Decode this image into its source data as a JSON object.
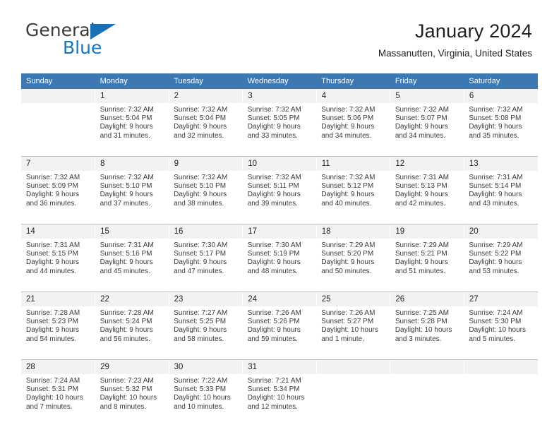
{
  "brand": {
    "name_top": "General",
    "name_bottom": "Blue",
    "mark": "triangle-logo",
    "color_blue": "#1577bf",
    "color_dark": "#3b3b3d"
  },
  "header": {
    "title": "January 2024",
    "subtitle": "Massanutten, Virginia, United States"
  },
  "theme": {
    "header_bg": "#3c79b4",
    "daynum_bg": "#f2f2f2",
    "row_divider": "#a9bcd2"
  },
  "calendar": {
    "weekday_headers": [
      "Sunday",
      "Monday",
      "Tuesday",
      "Wednesday",
      "Thursday",
      "Friday",
      "Saturday"
    ],
    "weeks": [
      {
        "days": [
          {
            "num": "",
            "sunrise": "",
            "sunset": "",
            "daylight1": "",
            "daylight2": ""
          },
          {
            "num": "1",
            "sunrise": "Sunrise: 7:32 AM",
            "sunset": "Sunset: 5:04 PM",
            "daylight1": "Daylight: 9 hours",
            "daylight2": "and 31 minutes."
          },
          {
            "num": "2",
            "sunrise": "Sunrise: 7:32 AM",
            "sunset": "Sunset: 5:04 PM",
            "daylight1": "Daylight: 9 hours",
            "daylight2": "and 32 minutes."
          },
          {
            "num": "3",
            "sunrise": "Sunrise: 7:32 AM",
            "sunset": "Sunset: 5:05 PM",
            "daylight1": "Daylight: 9 hours",
            "daylight2": "and 33 minutes."
          },
          {
            "num": "4",
            "sunrise": "Sunrise: 7:32 AM",
            "sunset": "Sunset: 5:06 PM",
            "daylight1": "Daylight: 9 hours",
            "daylight2": "and 34 minutes."
          },
          {
            "num": "5",
            "sunrise": "Sunrise: 7:32 AM",
            "sunset": "Sunset: 5:07 PM",
            "daylight1": "Daylight: 9 hours",
            "daylight2": "and 34 minutes."
          },
          {
            "num": "6",
            "sunrise": "Sunrise: 7:32 AM",
            "sunset": "Sunset: 5:08 PM",
            "daylight1": "Daylight: 9 hours",
            "daylight2": "and 35 minutes."
          }
        ]
      },
      {
        "days": [
          {
            "num": "7",
            "sunrise": "Sunrise: 7:32 AM",
            "sunset": "Sunset: 5:09 PM",
            "daylight1": "Daylight: 9 hours",
            "daylight2": "and 36 minutes."
          },
          {
            "num": "8",
            "sunrise": "Sunrise: 7:32 AM",
            "sunset": "Sunset: 5:10 PM",
            "daylight1": "Daylight: 9 hours",
            "daylight2": "and 37 minutes."
          },
          {
            "num": "9",
            "sunrise": "Sunrise: 7:32 AM",
            "sunset": "Sunset: 5:10 PM",
            "daylight1": "Daylight: 9 hours",
            "daylight2": "and 38 minutes."
          },
          {
            "num": "10",
            "sunrise": "Sunrise: 7:32 AM",
            "sunset": "Sunset: 5:11 PM",
            "daylight1": "Daylight: 9 hours",
            "daylight2": "and 39 minutes."
          },
          {
            "num": "11",
            "sunrise": "Sunrise: 7:32 AM",
            "sunset": "Sunset: 5:12 PM",
            "daylight1": "Daylight: 9 hours",
            "daylight2": "and 40 minutes."
          },
          {
            "num": "12",
            "sunrise": "Sunrise: 7:31 AM",
            "sunset": "Sunset: 5:13 PM",
            "daylight1": "Daylight: 9 hours",
            "daylight2": "and 42 minutes."
          },
          {
            "num": "13",
            "sunrise": "Sunrise: 7:31 AM",
            "sunset": "Sunset: 5:14 PM",
            "daylight1": "Daylight: 9 hours",
            "daylight2": "and 43 minutes."
          }
        ]
      },
      {
        "days": [
          {
            "num": "14",
            "sunrise": "Sunrise: 7:31 AM",
            "sunset": "Sunset: 5:15 PM",
            "daylight1": "Daylight: 9 hours",
            "daylight2": "and 44 minutes."
          },
          {
            "num": "15",
            "sunrise": "Sunrise: 7:31 AM",
            "sunset": "Sunset: 5:16 PM",
            "daylight1": "Daylight: 9 hours",
            "daylight2": "and 45 minutes."
          },
          {
            "num": "16",
            "sunrise": "Sunrise: 7:30 AM",
            "sunset": "Sunset: 5:17 PM",
            "daylight1": "Daylight: 9 hours",
            "daylight2": "and 47 minutes."
          },
          {
            "num": "17",
            "sunrise": "Sunrise: 7:30 AM",
            "sunset": "Sunset: 5:19 PM",
            "daylight1": "Daylight: 9 hours",
            "daylight2": "and 48 minutes."
          },
          {
            "num": "18",
            "sunrise": "Sunrise: 7:29 AM",
            "sunset": "Sunset: 5:20 PM",
            "daylight1": "Daylight: 9 hours",
            "daylight2": "and 50 minutes."
          },
          {
            "num": "19",
            "sunrise": "Sunrise: 7:29 AM",
            "sunset": "Sunset: 5:21 PM",
            "daylight1": "Daylight: 9 hours",
            "daylight2": "and 51 minutes."
          },
          {
            "num": "20",
            "sunrise": "Sunrise: 7:29 AM",
            "sunset": "Sunset: 5:22 PM",
            "daylight1": "Daylight: 9 hours",
            "daylight2": "and 53 minutes."
          }
        ]
      },
      {
        "days": [
          {
            "num": "21",
            "sunrise": "Sunrise: 7:28 AM",
            "sunset": "Sunset: 5:23 PM",
            "daylight1": "Daylight: 9 hours",
            "daylight2": "and 54 minutes."
          },
          {
            "num": "22",
            "sunrise": "Sunrise: 7:28 AM",
            "sunset": "Sunset: 5:24 PM",
            "daylight1": "Daylight: 9 hours",
            "daylight2": "and 56 minutes."
          },
          {
            "num": "23",
            "sunrise": "Sunrise: 7:27 AM",
            "sunset": "Sunset: 5:25 PM",
            "daylight1": "Daylight: 9 hours",
            "daylight2": "and 58 minutes."
          },
          {
            "num": "24",
            "sunrise": "Sunrise: 7:26 AM",
            "sunset": "Sunset: 5:26 PM",
            "daylight1": "Daylight: 9 hours",
            "daylight2": "and 59 minutes."
          },
          {
            "num": "25",
            "sunrise": "Sunrise: 7:26 AM",
            "sunset": "Sunset: 5:27 PM",
            "daylight1": "Daylight: 10 hours",
            "daylight2": "and 1 minute."
          },
          {
            "num": "26",
            "sunrise": "Sunrise: 7:25 AM",
            "sunset": "Sunset: 5:28 PM",
            "daylight1": "Daylight: 10 hours",
            "daylight2": "and 3 minutes."
          },
          {
            "num": "27",
            "sunrise": "Sunrise: 7:24 AM",
            "sunset": "Sunset: 5:30 PM",
            "daylight1": "Daylight: 10 hours",
            "daylight2": "and 5 minutes."
          }
        ]
      },
      {
        "days": [
          {
            "num": "28",
            "sunrise": "Sunrise: 7:24 AM",
            "sunset": "Sunset: 5:31 PM",
            "daylight1": "Daylight: 10 hours",
            "daylight2": "and 7 minutes."
          },
          {
            "num": "29",
            "sunrise": "Sunrise: 7:23 AM",
            "sunset": "Sunset: 5:32 PM",
            "daylight1": "Daylight: 10 hours",
            "daylight2": "and 8 minutes."
          },
          {
            "num": "30",
            "sunrise": "Sunrise: 7:22 AM",
            "sunset": "Sunset: 5:33 PM",
            "daylight1": "Daylight: 10 hours",
            "daylight2": "and 10 minutes."
          },
          {
            "num": "31",
            "sunrise": "Sunrise: 7:21 AM",
            "sunset": "Sunset: 5:34 PM",
            "daylight1": "Daylight: 10 hours",
            "daylight2": "and 12 minutes."
          },
          {
            "num": "",
            "sunrise": "",
            "sunset": "",
            "daylight1": "",
            "daylight2": ""
          },
          {
            "num": "",
            "sunrise": "",
            "sunset": "",
            "daylight1": "",
            "daylight2": ""
          },
          {
            "num": "",
            "sunrise": "",
            "sunset": "",
            "daylight1": "",
            "daylight2": ""
          }
        ]
      }
    ]
  }
}
